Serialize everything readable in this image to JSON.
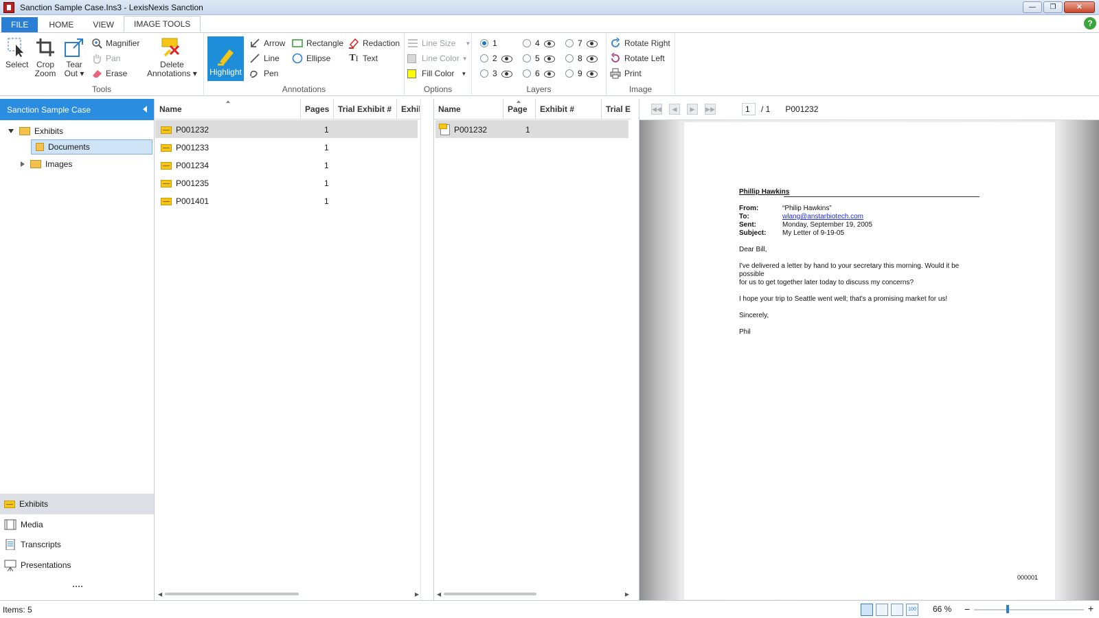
{
  "window": {
    "title": "Sanction Sample Case.Ins3 - LexisNexis Sanction",
    "controls": [
      "minimize",
      "restore",
      "close"
    ]
  },
  "ribbon_tabs": [
    {
      "label": "FILE"
    },
    {
      "label": "HOME"
    },
    {
      "label": "VIEW"
    },
    {
      "label": "IMAGE TOOLS",
      "active": true
    }
  ],
  "ribbon": {
    "tools": {
      "label": "Tools",
      "select": "Select",
      "crop_zoom": [
        "Crop",
        "Zoom"
      ],
      "tear_out": [
        "Tear",
        "Out"
      ],
      "magnifier": "Magnifier",
      "pan": "Pan",
      "erase": "Erase",
      "delete_annotations": [
        "Delete",
        "Annotations"
      ]
    },
    "annotations": {
      "label": "Annotations",
      "highlight": "Highlight",
      "arrow": "Arrow",
      "line": "Line",
      "pen": "Pen",
      "rectangle": "Rectangle",
      "ellipse": "Ellipse",
      "redaction": "Redaction",
      "text": "Text"
    },
    "options": {
      "label": "Options",
      "line_size": "Line Size",
      "line_color": "Line Color",
      "fill_color": "Fill Color",
      "fill_color_value": "#ffff00"
    },
    "layers": {
      "label": "Layers",
      "items": [
        "1",
        "2",
        "3",
        "4",
        "5",
        "6",
        "7",
        "8",
        "9"
      ],
      "selected": "1"
    },
    "image": {
      "label": "Image",
      "rotate_right": "Rotate Right",
      "rotate_left": "Rotate Left",
      "print": "Print"
    }
  },
  "left_panel": {
    "case_name": "Sanction Sample Case",
    "tree": [
      {
        "label": "Exhibits",
        "expanded": true
      },
      {
        "label": "Documents",
        "selected": true
      },
      {
        "label": "Images",
        "expanded": false
      }
    ],
    "nav": [
      {
        "label": "Exhibits",
        "selected": true
      },
      {
        "label": "Media"
      },
      {
        "label": "Transcripts"
      },
      {
        "label": "Presentations"
      }
    ]
  },
  "exhibit_grid": {
    "columns": [
      "Name",
      "Pages",
      "Trial Exhibit #",
      "Exhib"
    ],
    "rows": [
      {
        "name": "P001232",
        "pages": "1"
      },
      {
        "name": "P001233",
        "pages": "1"
      },
      {
        "name": "P001234",
        "pages": "1"
      },
      {
        "name": "P001235",
        "pages": "1"
      },
      {
        "name": "P001401",
        "pages": "1"
      }
    ]
  },
  "page_grid": {
    "columns": [
      "Name",
      "Page",
      "Exhibit #",
      "Trial E"
    ],
    "rows": [
      {
        "name": "P001232",
        "page": "1"
      }
    ]
  },
  "viewer": {
    "page_current": "1",
    "page_total": "/ 1",
    "doc_id": "P001232",
    "document": {
      "heading": "Phillip Hawkins",
      "from_label": "From:",
      "from_value": "“Philip Hawkins”",
      "to_label": "To:",
      "to_value": "wlang@anstarbiotech.com",
      "sent_label": "Sent:",
      "sent_value": "Monday, September 19, 2005",
      "subject_label": "Subject:",
      "subject_value": "My Letter of 9-19-05",
      "greeting": "Dear Bill,",
      "para1_line1": "I've delivered a letter by hand to your secretary this morning.  Would it be",
      "para1_line2": "possible",
      "para1_line3": "for us to get together later today to discuss my concerns?",
      "para2": "I hope your trip to Seattle went well; that's a promising market for us!",
      "closing": "Sincerely,",
      "signature": "Phil",
      "bates": "000001"
    }
  },
  "status": {
    "items": "Items: 5",
    "zoom": "66 %",
    "zoom_minus": "−",
    "zoom_plus": "+"
  }
}
